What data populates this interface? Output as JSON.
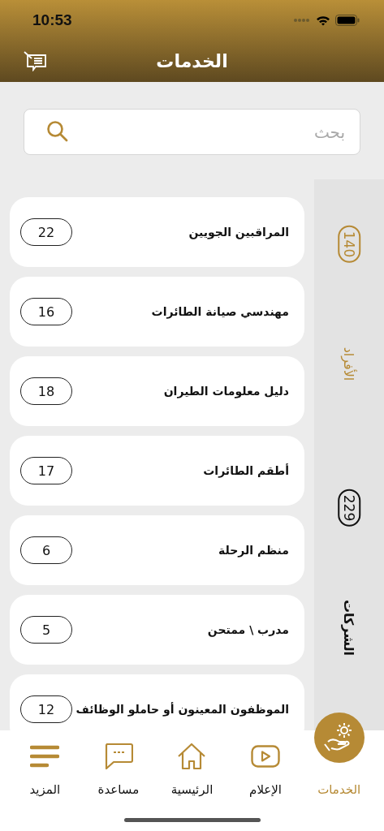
{
  "status_bar": {
    "time": "10:53"
  },
  "header": {
    "title": "الخدمات"
  },
  "search": {
    "placeholder": "بحث"
  },
  "categories": [
    {
      "label": "الأفراد",
      "count": "140",
      "selected": true
    },
    {
      "label": "الشركات",
      "count": "229",
      "selected": false
    }
  ],
  "services": [
    {
      "name": "المراقبين الجويين",
      "count": "22"
    },
    {
      "name": "مهندسي صيانة الطائرات",
      "count": "16"
    },
    {
      "name": "دليل معلومات الطيران",
      "count": "18"
    },
    {
      "name": "أطقم الطائرات",
      "count": "17"
    },
    {
      "name": "منظم الرحلة",
      "count": "6"
    },
    {
      "name": "مدرب \\ ممتحن",
      "count": "5"
    },
    {
      "name": "الموظفون المعينون أو حاملو الوظائف",
      "count": "12"
    }
  ],
  "tab_bar": [
    {
      "label": "الخدمات",
      "kind": "services",
      "selected": true
    },
    {
      "label": "الإعلام",
      "kind": "media",
      "selected": false
    },
    {
      "label": "الرئيسية",
      "kind": "home",
      "selected": false
    },
    {
      "label": "مساعدة",
      "kind": "help",
      "selected": false
    },
    {
      "label": "المزيد",
      "kind": "more",
      "selected": false
    }
  ]
}
